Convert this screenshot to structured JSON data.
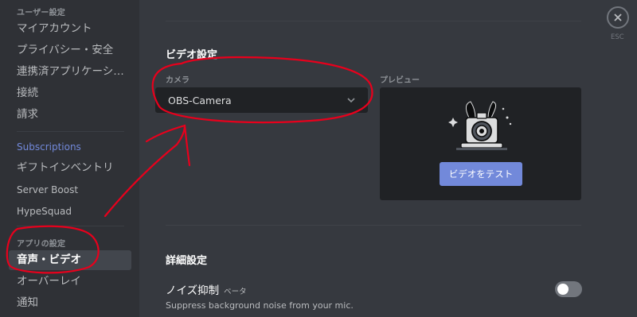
{
  "sidebar": {
    "user_settings_header": "ユーザー設定",
    "my_account": "マイアカウント",
    "privacy_safety": "プライバシー・安全",
    "authorized_apps": "連携済アプリケーショ...",
    "connections": "接続",
    "billing": "請求",
    "subscriptions": "Subscriptions",
    "gift_inventory": "ギフトインベントリ",
    "server_boost": "Server Boost",
    "hypesquad": "HypeSquad",
    "app_settings_header": "アプリの設定",
    "voice_video": "音声・ビデオ",
    "overlay": "オーバーレイ",
    "notifications": "通知"
  },
  "video": {
    "section_title": "ビデオ設定",
    "camera_label": "カメラ",
    "camera_value": "OBS-Camera",
    "preview_label": "プレビュー",
    "test_button": "ビデオをテスト"
  },
  "advanced": {
    "title": "詳細設定",
    "noise_label": "ノイズ抑制",
    "beta": "ベータ",
    "noise_desc": "Suppress background noise from your mic.",
    "noise_enabled": false
  },
  "close": {
    "esc_label": "ESC"
  },
  "colors": {
    "accent": "#7289da",
    "annotation_red": "#e8001c",
    "background": "#36393f",
    "sidebar": "#2f3136"
  }
}
